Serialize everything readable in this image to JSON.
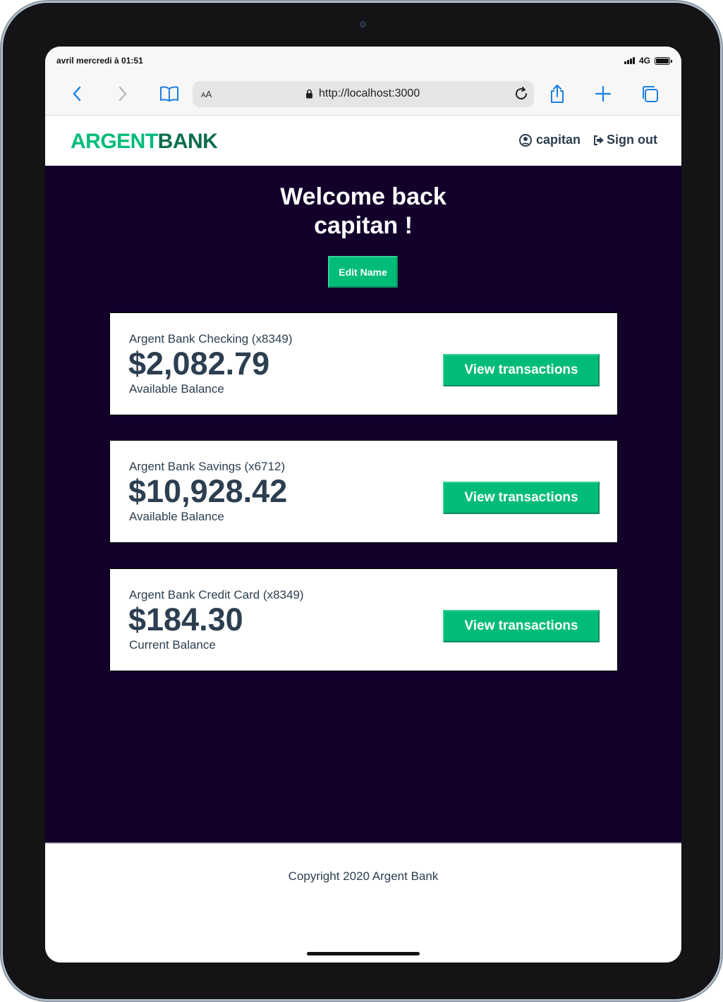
{
  "status_bar": {
    "time": "avril mercredi à 01:51",
    "network": "4G"
  },
  "browser": {
    "text_size_label_small": "A",
    "text_size_label_large": "A",
    "url": "http://localhost:3000",
    "icons": [
      "back-icon",
      "forward-icon",
      "bookmarks-icon",
      "lock-icon",
      "reload-icon",
      "share-icon",
      "new-tab-icon",
      "tabs-icon"
    ]
  },
  "header": {
    "logo_part1": "ARGENT",
    "logo_part2": "BANK",
    "user_name": "capitan",
    "sign_out_label": "Sign out"
  },
  "welcome": {
    "line1": "Welcome back",
    "line2": "capitan !",
    "edit_button_label": "Edit Name"
  },
  "accounts": [
    {
      "title": "Argent Bank Checking (x8349)",
      "amount": "$2,082.79",
      "description": "Available Balance",
      "button_label": "View transactions"
    },
    {
      "title": "Argent Bank Savings (x6712)",
      "amount": "$10,928.42",
      "description": "Available Balance",
      "button_label": "View transactions"
    },
    {
      "title": "Argent Bank Credit Card (x8349)",
      "amount": "$184.30",
      "description": "Current Balance",
      "button_label": "View transactions"
    }
  ],
  "footer": {
    "copyright": "Copyright 2020 Argent Bank"
  },
  "colors": {
    "accent": "#00bc77",
    "logo_dark": "#0c6e4a",
    "main_bg": "#12002b",
    "text": "#2c3e50",
    "safari_blue": "#1a7fe0"
  }
}
